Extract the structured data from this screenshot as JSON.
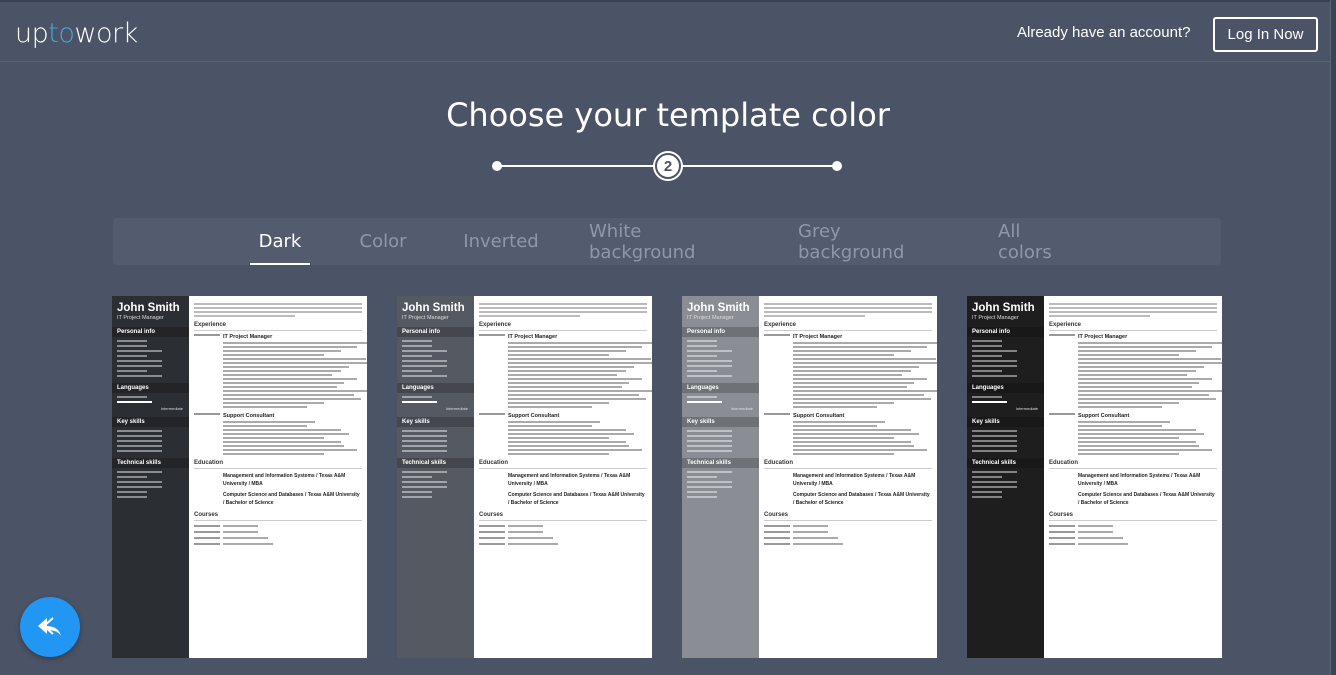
{
  "header": {
    "logo": {
      "part1": "up",
      "part2": "to",
      "part3": "work"
    },
    "account_prompt": "Already have an account?",
    "login_label": "Log In Now"
  },
  "page": {
    "title": "Choose your template color",
    "stepper": {
      "current_step": "2",
      "total_steps": 3
    }
  },
  "tabs": [
    {
      "label": "Dark",
      "active": true
    },
    {
      "label": "Color",
      "active": false
    },
    {
      "label": "Inverted",
      "active": false
    },
    {
      "label": "White background",
      "active": false
    },
    {
      "label": "Grey background",
      "active": false
    },
    {
      "label": "All colors",
      "active": false
    }
  ],
  "resume": {
    "name": "John Smith",
    "role": "IT Project Manager",
    "sections_side": [
      "Personal info",
      "Languages",
      "Key skills",
      "Technical skills"
    ],
    "language_level": "Intermediate",
    "sections_main": [
      "Experience",
      "Education",
      "Courses"
    ],
    "jobs": [
      "IT Project Manager",
      "Support Consultant"
    ],
    "education": [
      "Management and Information Systems / Texas A&M University / MBA",
      "Computer Science and Databases / Texas A&M University / Bachelor of Science"
    ]
  },
  "templates": [
    {
      "id": "dark-1",
      "sidebar_color": "#2b2e33"
    },
    {
      "id": "dark-2",
      "sidebar_color": "#555a62"
    },
    {
      "id": "dark-3",
      "sidebar_color": "#8a8e94"
    },
    {
      "id": "dark-4",
      "sidebar_color": "#1e1e1e"
    }
  ],
  "fab": {
    "icon": "reply-icon"
  }
}
